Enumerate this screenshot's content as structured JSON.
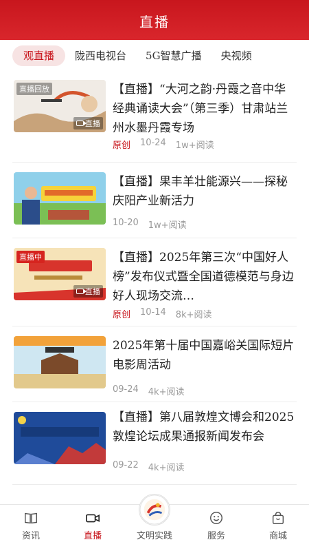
{
  "header": {
    "title": "直播"
  },
  "tabs": [
    {
      "label": "观直播"
    },
    {
      "label": "陇西电视台"
    },
    {
      "label": "5G智慧广播"
    },
    {
      "label": "央视频"
    }
  ],
  "feed": [
    {
      "title": "【直播】“大河之韵·丹霞之音中华经典诵读大会”（第三季）甘肃站兰州水墨丹霞专场",
      "origin": "原创",
      "date": "10-24",
      "reads": "1w+阅读",
      "thumb_tag": "直播回放",
      "thumb_live": "直播"
    },
    {
      "title": "【直播】果丰羊壮能源兴——探秘庆阳产业新活力",
      "origin": "",
      "date": "10-20",
      "reads": "1w+阅读",
      "thumb_tag": "",
      "thumb_live": ""
    },
    {
      "title": "【直播】2025年第三次“中国好人榜”发布仪式暨全国道德模范与身边好人现场交流…",
      "origin": "原创",
      "date": "10-14",
      "reads": "8k+阅读",
      "thumb_tag": "直播中",
      "thumb_live": "直播"
    },
    {
      "title": "2025年第十届中国嘉峪关国际短片电影周活动",
      "origin": "",
      "date": "09-24",
      "reads": "4k+阅读",
      "thumb_tag": "",
      "thumb_live": ""
    },
    {
      "title": "【直播】第八届敦煌文博会和2025敦煌论坛成果通报新闻发布会",
      "origin": "",
      "date": "09-22",
      "reads": "4k+阅读",
      "thumb_tag": "",
      "thumb_live": ""
    }
  ],
  "tabbar": [
    {
      "label": "资讯",
      "icon": "book-icon"
    },
    {
      "label": "直播",
      "icon": "video-camera-icon"
    },
    {
      "label": "文明实践",
      "icon": "logo-emblem-icon"
    },
    {
      "label": "服务",
      "icon": "smile-icon"
    },
    {
      "label": "商城",
      "icon": "shopping-bag-icon"
    }
  ],
  "colors": {
    "brand": "#c8161d",
    "active_tab_bg": "#f7e3e3"
  }
}
